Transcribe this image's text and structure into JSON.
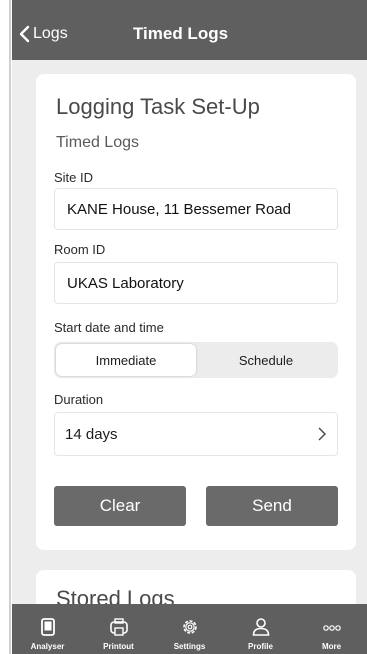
{
  "nav": {
    "back_label": "Logs",
    "title": "Timed Logs"
  },
  "form": {
    "title": "Logging Task Set-Up",
    "subtitle": "Timed Logs",
    "site_label": "Site ID",
    "site_value": "KANE House, 11 Bessemer Road",
    "room_label": "Room ID",
    "room_value": "UKAS Laboratory",
    "start_label": "Start date and time",
    "start_options": [
      "Immediate",
      "Schedule"
    ],
    "start_selected": "Immediate",
    "duration_label": "Duration",
    "duration_value": "14 days",
    "clear_label": "Clear",
    "send_label": "Send"
  },
  "stored": {
    "title": "Stored Logs"
  },
  "tabbar": {
    "items": [
      {
        "label": "Analyser",
        "icon": "analyser-icon"
      },
      {
        "label": "Printout",
        "icon": "printer-icon"
      },
      {
        "label": "Settings",
        "icon": "gear-icon"
      },
      {
        "label": "Profile",
        "icon": "profile-icon"
      },
      {
        "label": "More",
        "icon": "more-icon"
      }
    ]
  },
  "colors": {
    "bar": "#5f5f5f",
    "button": "#6a6a6a",
    "background": "#ededed"
  }
}
